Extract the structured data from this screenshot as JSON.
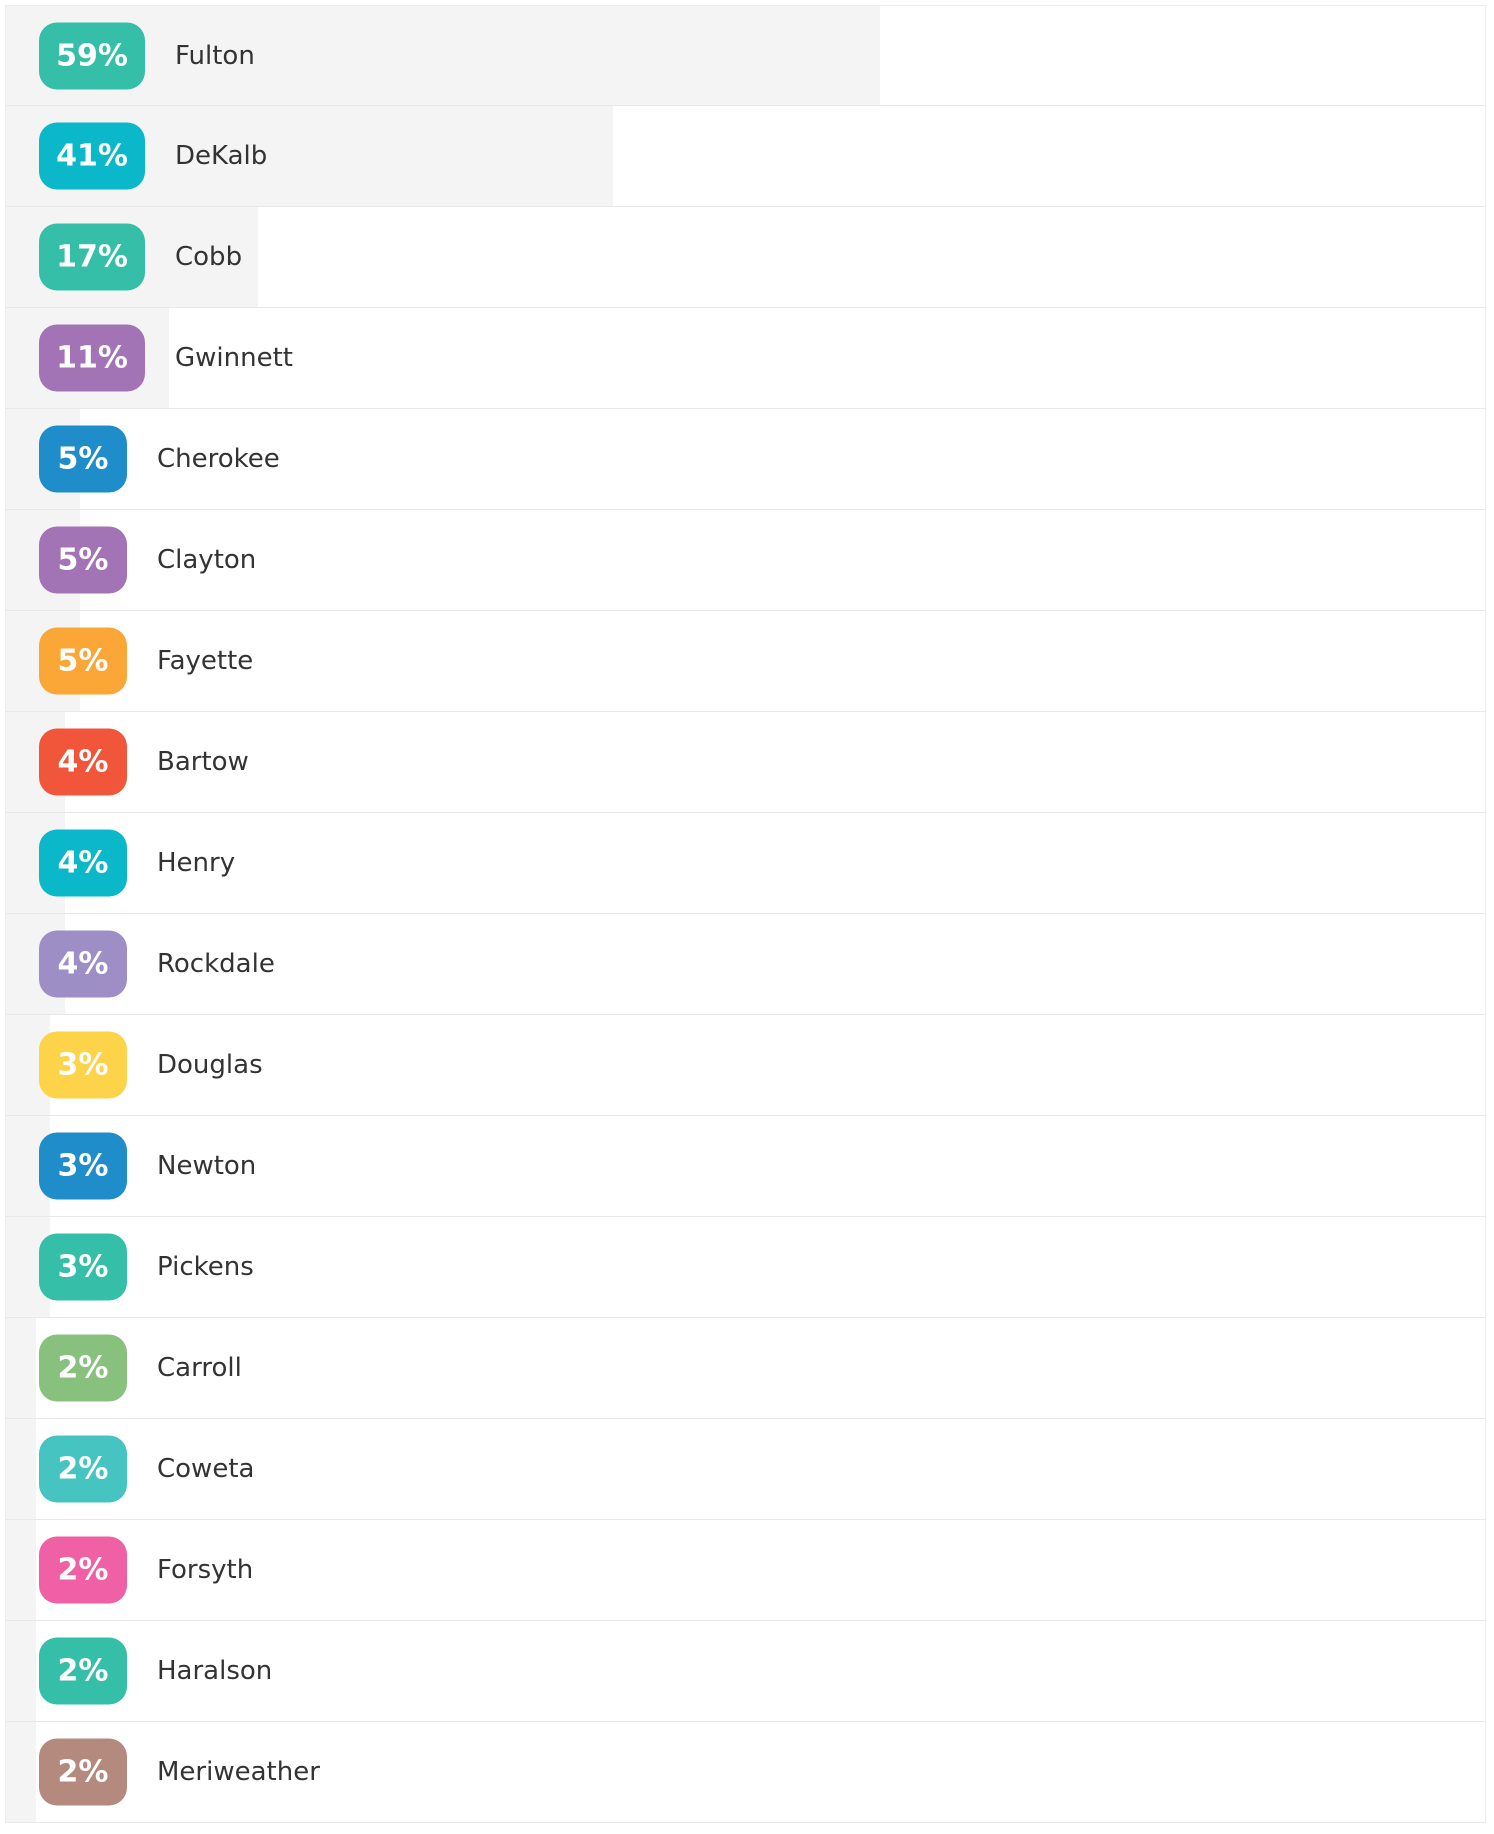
{
  "chart_data": {
    "type": "bar",
    "categories": [
      "Fulton",
      "DeKalb",
      "Cobb",
      "Gwinnett",
      "Cherokee",
      "Clayton",
      "Fayette",
      "Bartow",
      "Henry",
      "Rockdale",
      "Douglas",
      "Newton",
      "Pickens",
      "Carroll",
      "Coweta",
      "Forsyth",
      "Haralson",
      "Meriweather"
    ],
    "values": [
      59,
      41,
      17,
      11,
      5,
      5,
      5,
      4,
      4,
      4,
      3,
      3,
      3,
      2,
      2,
      2,
      2,
      2
    ],
    "labels": [
      "59%",
      "41%",
      "17%",
      "11%",
      "5%",
      "5%",
      "5%",
      "4%",
      "4%",
      "4%",
      "3%",
      "3%",
      "3%",
      "2%",
      "2%",
      "2%",
      "2%",
      "2%"
    ],
    "colors": [
      "#35bfa8",
      "#0ab8c9",
      "#35bfa8",
      "#a273b5",
      "#1f8dca",
      "#a273b5",
      "#fba738",
      "#f1553a",
      "#0ab8c9",
      "#9d8ec6",
      "#fdd34a",
      "#1f8dca",
      "#35bfa8",
      "#88c17d",
      "#45c4c1",
      "#f060a4",
      "#35bfa8",
      "#b48a7e"
    ],
    "xlim": [
      0,
      100
    ],
    "bar_fill_color": "#f4f4f4"
  }
}
